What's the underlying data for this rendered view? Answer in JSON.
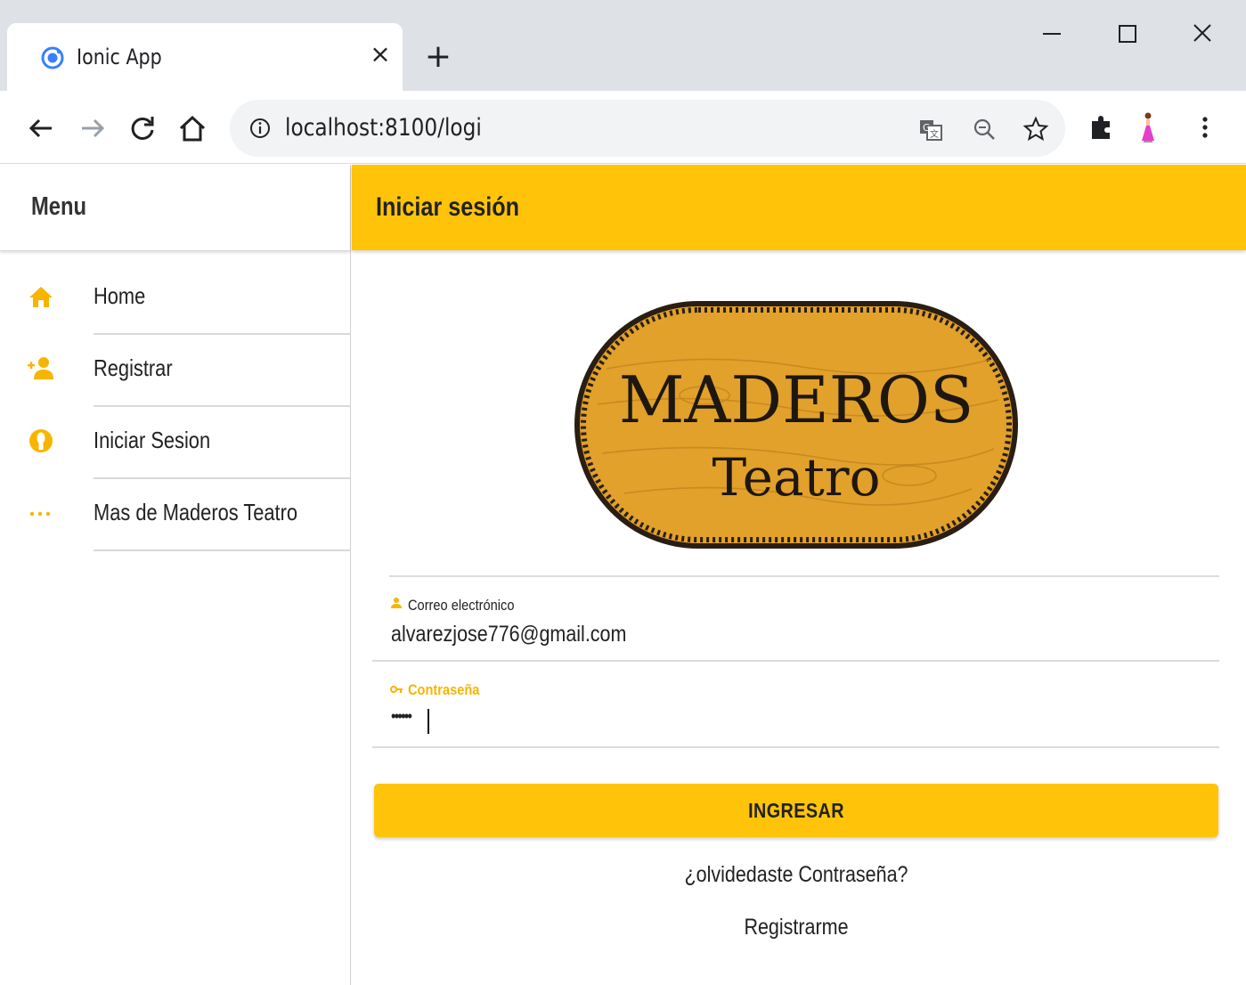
{
  "browser": {
    "tab_title": "Ionic App",
    "tab_close_glyph": "×",
    "new_tab_glyph": "+",
    "url": "localhost:8100/logi",
    "window_controls": [
      "minimize",
      "maximize",
      "close"
    ],
    "toolbar_icons": [
      "translate-icon",
      "zoom-icon",
      "bookmark-star-icon",
      "extensions-icon",
      "profile-avatar-icon",
      "more-menu-icon"
    ]
  },
  "menu": {
    "title": "Menu",
    "items": [
      {
        "label": "Home",
        "icon": "home-icon"
      },
      {
        "label": "Registrar",
        "icon": "person-add-icon"
      },
      {
        "label": "Iniciar Sesion",
        "icon": "user-circle-icon"
      },
      {
        "label": "Mas de Maderos Teatro",
        "icon": "ellipsis-icon"
      }
    ]
  },
  "page": {
    "title": "Iniciar sesión",
    "logo": {
      "line1": "MADEROS",
      "line2": "Teatro"
    },
    "email": {
      "label": "Correo electrónico",
      "value": "alvarezjose776@gmail.com"
    },
    "password": {
      "label": "Contraseña",
      "value": "••••••"
    },
    "submit_label": "INGRESAR",
    "forgot_label": "¿olvidedaste Contraseña?",
    "register_label": "Registrarme"
  },
  "colors": {
    "accent": "#ffc409",
    "icon_accent": "#f7b500",
    "chrome_bg": "#dee1e6",
    "wood": "#e1a12a"
  }
}
